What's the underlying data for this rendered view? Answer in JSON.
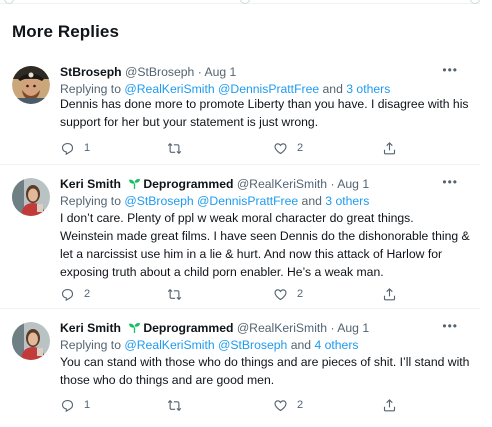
{
  "section_title": "More Replies",
  "replying_label": "Replying to",
  "tweets": [
    {
      "name": "StBroseph",
      "handle": "@StBroseph",
      "date": "Aug 1",
      "reply_mentions": "@RealKeriSmith @DennisPrattFree",
      "reply_and": "and",
      "reply_others": "3 others",
      "text": "Dennis has done more to promote Liberty than you have. I disagree with his support for her but your statement is just wrong.",
      "replies": "1",
      "retweets": "",
      "likes": "2"
    },
    {
      "name": "Keri Smith",
      "name_suffix": "Deprogrammed",
      "handle": "@RealKeriSmith",
      "date": "Aug 1",
      "reply_mentions": "@StBroseph @DennisPrattFree",
      "reply_and": "and",
      "reply_others": "3 others",
      "text": "I don’t care. Plenty of ppl w weak moral character do great things. Weinstein made great films. I have seen Dennis do the dishonorable thing & let a narcissist use him in a lie & hurt. And now this attack of Harlow for exposing truth about a child porn enabler. He’s a weak man.",
      "replies": "2",
      "retweets": "",
      "likes": "2"
    },
    {
      "name": "Keri Smith",
      "name_suffix": "Deprogrammed",
      "handle": "@RealKeriSmith",
      "date": "Aug 1",
      "reply_mentions": "@RealKeriSmith @StBroseph",
      "reply_and": "and",
      "reply_others": "4 others",
      "text": "You can stand with those who do things and are pieces of shit. I’ll stand with those who do things and are good men.",
      "replies": "1",
      "retweets": "",
      "likes": "2"
    }
  ],
  "icons": {
    "reply": "reply-icon",
    "retweet": "retweet-icon",
    "like": "heart-icon",
    "share": "share-icon",
    "more": "more-icon",
    "leaf": "seedling-icon"
  },
  "colors": {
    "accent": "#1d9bf0",
    "secondary_text": "#536471",
    "primary_text": "#0f1419",
    "leaf": "#17bf63"
  }
}
